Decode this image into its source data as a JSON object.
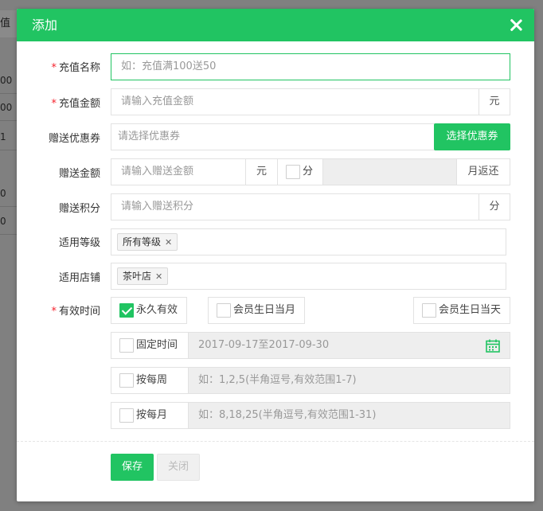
{
  "background": {
    "header_fragment": "值金",
    "cells": [
      "00",
      "00",
      "1",
      "0",
      "0"
    ]
  },
  "dialog": {
    "title": "添加",
    "close_icon": "close-icon"
  },
  "form": {
    "name": {
      "label": "充值名称",
      "required": true,
      "placeholder": "如：充值满100送50"
    },
    "amount": {
      "label": "充值金额",
      "required": true,
      "placeholder": "请输入充值金额",
      "unit": "元"
    },
    "coupon": {
      "label": "赠送优惠券",
      "placeholder": "请选择优惠券",
      "button": "选择优惠券"
    },
    "gift_amount": {
      "label": "赠送金额",
      "placeholder": "请输入赠送金额",
      "unit": "元",
      "split_label": "分",
      "monthly_label": "月返还"
    },
    "points": {
      "label": "赠送积分",
      "placeholder": "请输入赠送积分",
      "unit": "分"
    },
    "level": {
      "label": "适用等级",
      "tags": [
        "所有等级"
      ]
    },
    "store": {
      "label": "适用店铺",
      "tags": [
        "茶叶店"
      ]
    },
    "validity": {
      "label": "有效时间",
      "required": true,
      "permanent": "永久有效",
      "birthday_month": "会员生日当月",
      "birthday_day": "会员生日当天",
      "fixed": "固定时间",
      "fixed_value": "2017-09-17至2017-09-30",
      "weekly": "按每周",
      "weekly_placeholder": "如：1,2,5(半角逗号,有效范围1-7)",
      "monthly": "按每月",
      "monthly_placeholder": "如：8,18,25(半角逗号,有效范围1-31)"
    }
  },
  "footer": {
    "save": "保存",
    "close": "关闭"
  },
  "colors": {
    "accent": "#21c462",
    "required": "#f5222d"
  }
}
